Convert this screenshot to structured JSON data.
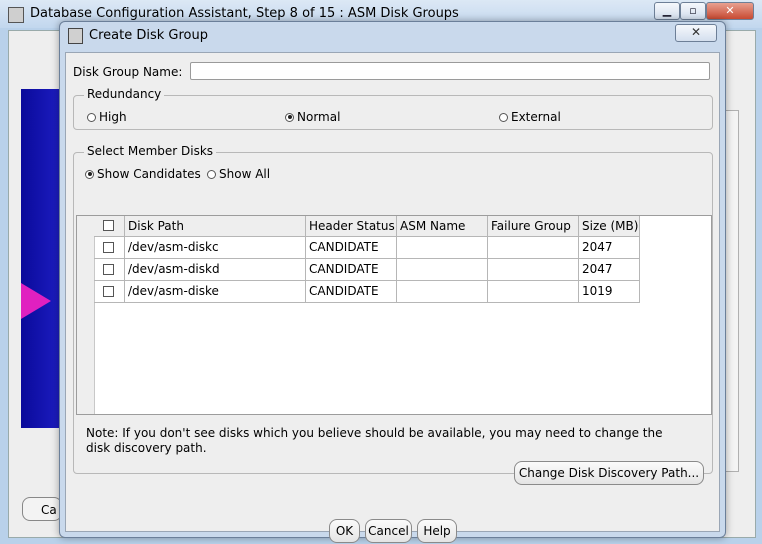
{
  "parent_window": {
    "title": "Database Configuration Assistant, Step 8 of 15 : ASM Disk Groups",
    "bottom_button_partial": "Ca"
  },
  "dialog": {
    "title": "Create Disk Group",
    "disk_group_name_label": "Disk Group Name:",
    "disk_group_name_value": "",
    "redundancy": {
      "legend": "Redundancy",
      "options": [
        "High",
        "Normal",
        "External"
      ],
      "selected": "Normal"
    },
    "member_disks": {
      "legend": "Select Member Disks",
      "filter_options": [
        "Show Candidates",
        "Show All"
      ],
      "selected_filter": "Show Candidates",
      "columns": [
        "Disk Path",
        "Header Status",
        "ASM Name",
        "Failure Group",
        "Size (MB)"
      ],
      "rows": [
        {
          "path": "/dev/asm-diskc",
          "status": "CANDIDATE",
          "asm_name": "",
          "failure_group": "",
          "size": "2047"
        },
        {
          "path": "/dev/asm-diskd",
          "status": "CANDIDATE",
          "asm_name": "",
          "failure_group": "",
          "size": "2047"
        },
        {
          "path": "/dev/asm-diske",
          "status": "CANDIDATE",
          "asm_name": "",
          "failure_group": "",
          "size": "1019"
        }
      ],
      "note": "Note: If you don't see disks which you believe should be available, you may need to change the disk discovery path.",
      "change_path_button": "Change Disk Discovery Path..."
    },
    "buttons": {
      "ok": "OK",
      "cancel": "Cancel",
      "help": "Help"
    }
  },
  "icons": {
    "app": "database-app-icon",
    "close": "close-icon",
    "minimize": "minimize-icon",
    "maximize": "maximize-icon"
  }
}
